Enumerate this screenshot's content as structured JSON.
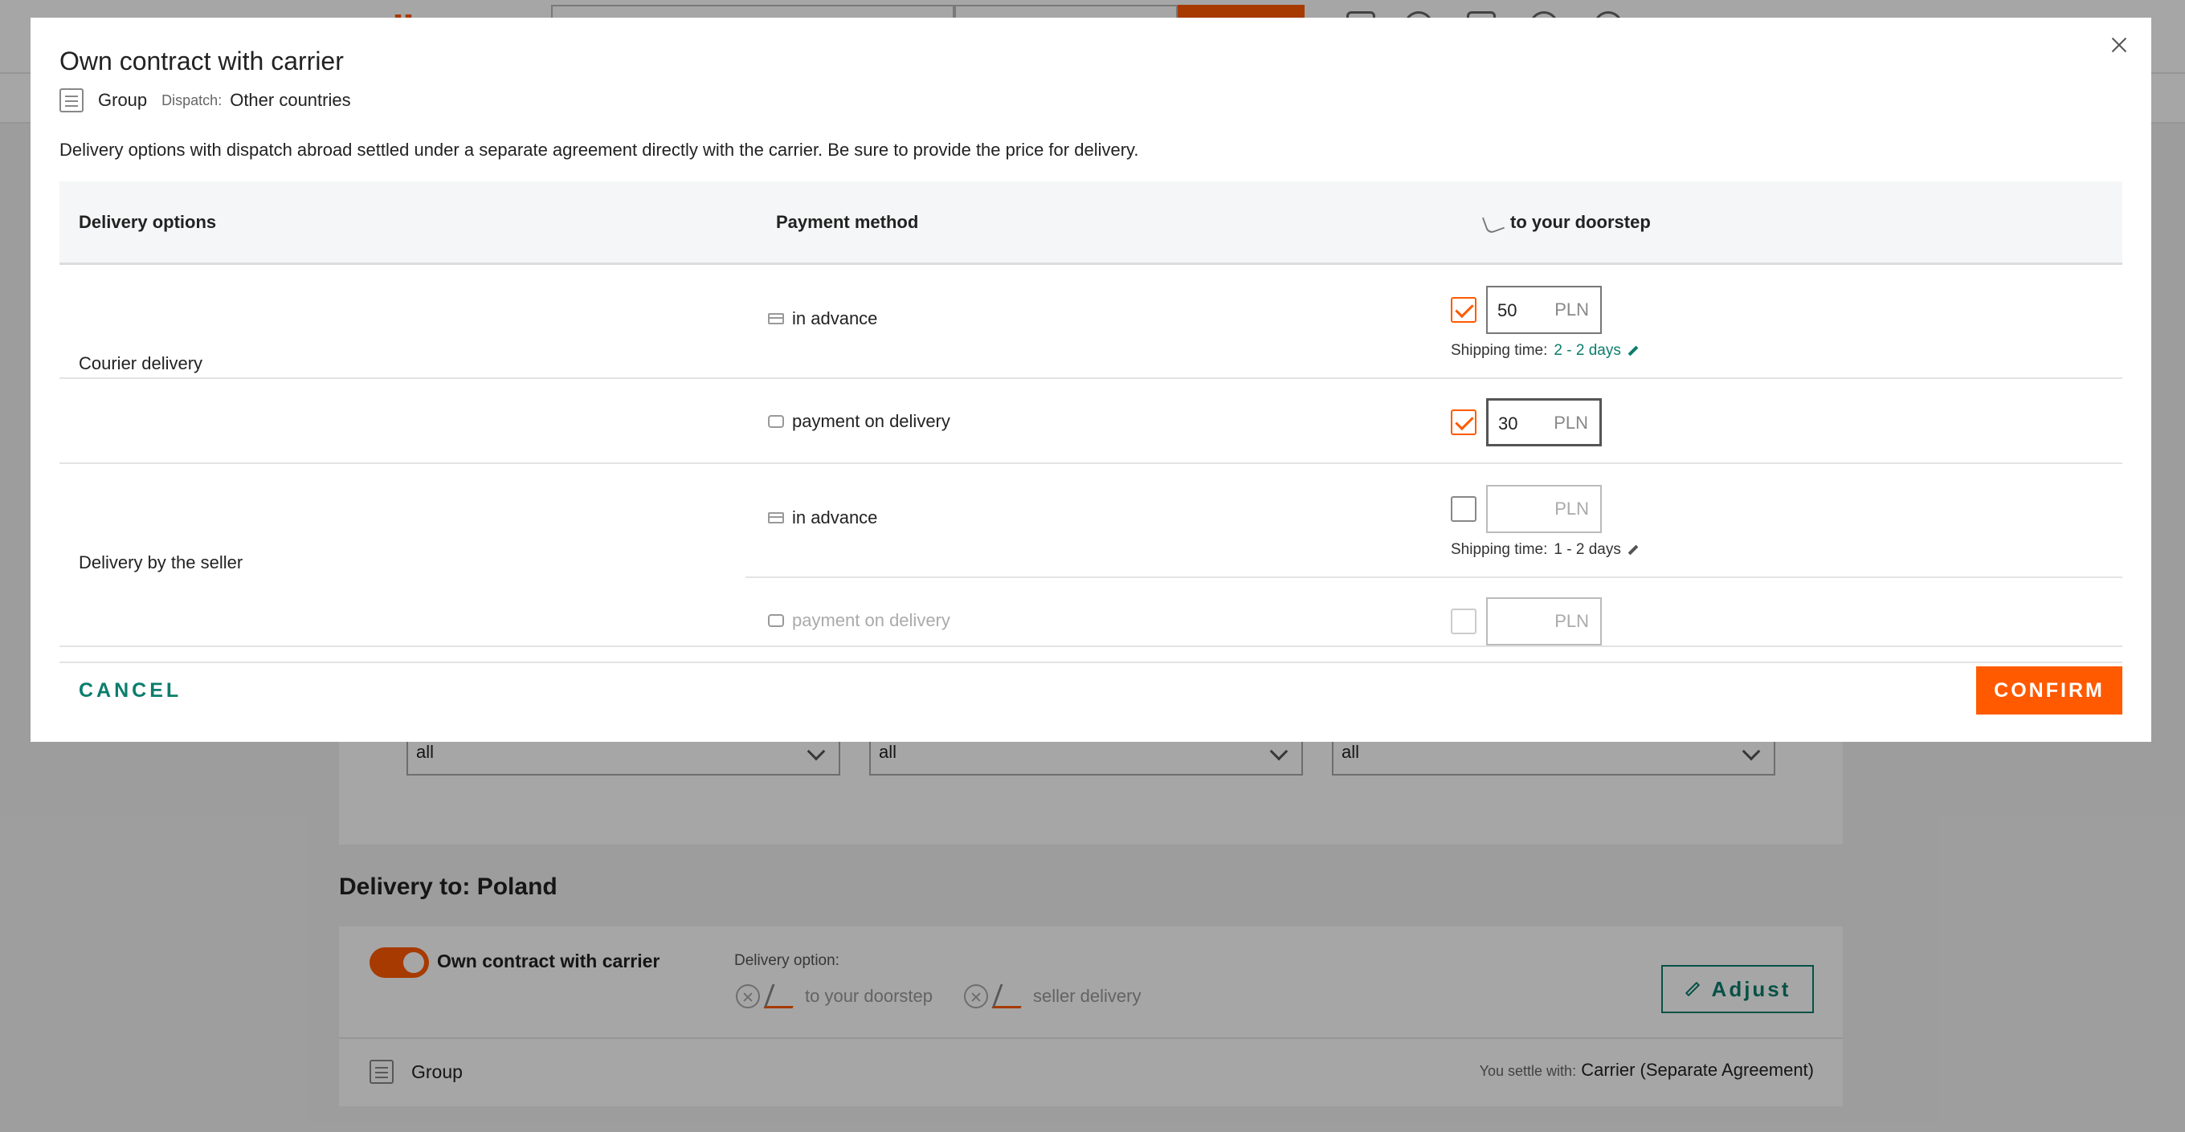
{
  "background": {
    "filters": [
      "all",
      "all",
      "all"
    ],
    "delivery_title": "Delivery to: Poland",
    "carrier_card": {
      "toggle_label": "Own contract with carrier",
      "delivery_option_label": "Delivery option:",
      "options": [
        "to your doorstep",
        "seller delivery"
      ],
      "adjust_label": "Adjust",
      "group_label": "Group",
      "settle_label": "You settle with:",
      "settle_value": "Carrier (Separate Agreement)"
    }
  },
  "modal": {
    "title": "Own contract with carrier",
    "group_label": "Group",
    "dispatch_label": "Dispatch:",
    "dispatch_value": "Other countries",
    "description": "Delivery options with dispatch abroad settled under a separate agreement directly with the carrier. Be sure to provide the price for delivery.",
    "table": {
      "headers": {
        "delivery_options": "Delivery options",
        "payment_method": "Payment method",
        "doorstep": "to your doorstep"
      },
      "groups": [
        {
          "name": "Courier delivery",
          "rows": [
            {
              "method": "in advance",
              "checked": true,
              "price": "50",
              "currency": "PLN",
              "shipping_label": "Shipping time:",
              "shipping_time": "2 - 2 days"
            },
            {
              "method": "payment on delivery",
              "checked": true,
              "price": "30",
              "currency": "PLN"
            }
          ]
        },
        {
          "name": "Delivery by the seller",
          "rows": [
            {
              "method": "in advance",
              "checked": false,
              "price": "",
              "currency": "PLN",
              "shipping_label": "Shipping time:",
              "shipping_time": "1 - 2 days"
            },
            {
              "method": "payment on delivery",
              "checked": false,
              "price": "",
              "currency": "PLN",
              "disabled": true
            }
          ]
        }
      ]
    },
    "cancel_label": "CANCEL",
    "confirm_label": "CONFIRM"
  },
  "colors": {
    "accent": "#ff5a00",
    "link": "#0b7d6c"
  }
}
